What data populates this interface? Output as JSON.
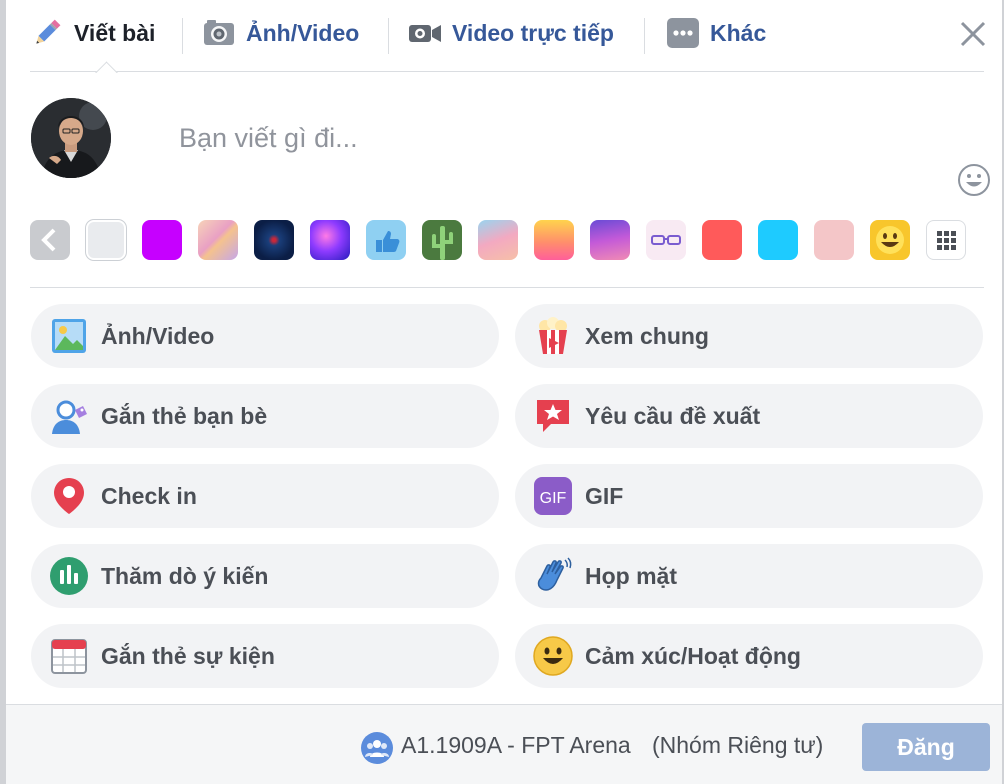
{
  "tabs": [
    {
      "label": "Viết bài",
      "icon": "pencil-icon"
    },
    {
      "label": "Ảnh/Video",
      "icon": "camera-icon"
    },
    {
      "label": "Video trực tiếp",
      "icon": "video-camera-icon"
    },
    {
      "label": "Khác",
      "icon": "more-icon"
    }
  ],
  "composer": {
    "placeholder": "Bạn viết gì đi...",
    "avatar_icon": "user-avatar"
  },
  "backgrounds": [
    {
      "name": "back",
      "color": "#c9cbcf"
    },
    {
      "name": "plain",
      "color": "#e9ebee"
    },
    {
      "name": "purple",
      "color": "#c600ff"
    },
    {
      "name": "peach-gradient",
      "color": "#f2b6a0"
    },
    {
      "name": "dark-blue-floral",
      "color": "#0f2a5c"
    },
    {
      "name": "violet-orb",
      "color": "#8e44ff"
    },
    {
      "name": "thumbs-up",
      "color": "#84c7f0"
    },
    {
      "name": "cactus",
      "color": "#3f7a3c"
    },
    {
      "name": "pastel-wave",
      "color": "#e9a3b8"
    },
    {
      "name": "sunset-gradient",
      "color": "#ff9a6a"
    },
    {
      "name": "purple-wave",
      "color": "#9b59d0"
    },
    {
      "name": "glasses",
      "color": "#f7e6f0"
    },
    {
      "name": "red",
      "color": "#ff5a5a"
    },
    {
      "name": "cyan",
      "color": "#1ecbff"
    },
    {
      "name": "light-pink",
      "color": "#f4c6c8"
    },
    {
      "name": "smiley",
      "color": "#f8c62c"
    },
    {
      "name": "grid",
      "color": "#ffffff"
    }
  ],
  "options": [
    {
      "label": "Ảnh/Video",
      "icon": "photo-icon"
    },
    {
      "label": "Xem chung",
      "icon": "popcorn-icon"
    },
    {
      "label": "Gắn thẻ bạn bè",
      "icon": "tag-friends-icon"
    },
    {
      "label": "Yêu cầu đề xuất",
      "icon": "recommendation-icon"
    },
    {
      "label": "Check in",
      "icon": "location-pin-icon"
    },
    {
      "label": "GIF",
      "icon": "gif-icon"
    },
    {
      "label": "Thăm dò ý kiến",
      "icon": "poll-icon"
    },
    {
      "label": "Họp mặt",
      "icon": "waving-hand-icon"
    },
    {
      "label": "Gắn thẻ sự kiện",
      "icon": "calendar-icon"
    },
    {
      "label": "Cảm xúc/Hoạt động",
      "icon": "smiley-icon"
    }
  ],
  "footer": {
    "group_name": "A1.1909A - FPT Arena",
    "group_privacy": "(Nhóm Riêng tư)",
    "post_label": "Đăng",
    "group_icon": "group-icon"
  },
  "colors": {
    "accent": "#365899",
    "post_button_disabled": "#9cb4d8",
    "option_bg": "#f2f3f5"
  }
}
